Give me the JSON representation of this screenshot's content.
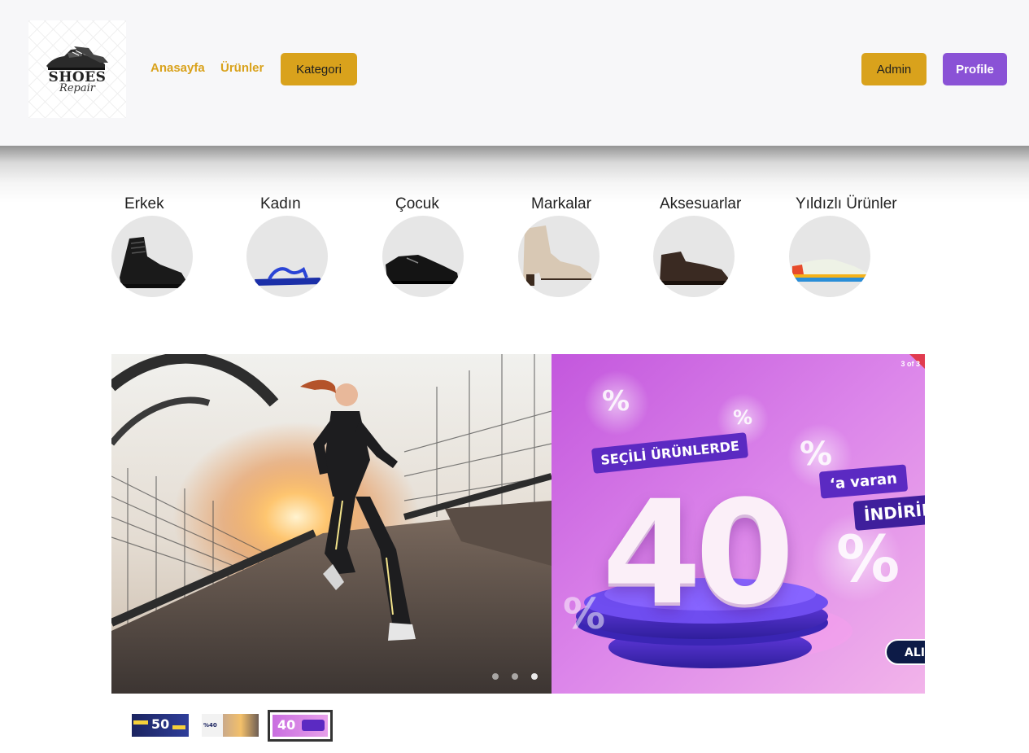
{
  "header": {
    "logo": {
      "title": "SHOES",
      "subtitle": "Repair"
    },
    "nav": {
      "home": "Anasayfa",
      "products": "Ürünler",
      "category": "Kategori"
    },
    "admin_label": "Admin",
    "profile_label": "Profile"
  },
  "categories": [
    {
      "label": "Erkek"
    },
    {
      "label": "Kadın"
    },
    {
      "label": "Çocuk"
    },
    {
      "label": "Markalar"
    },
    {
      "label": "Aksesuarlar"
    },
    {
      "label": "Yıldızlı Ürünler"
    }
  ],
  "carousel": {
    "counter": "3 of 3",
    "promo": {
      "tag1": "SEÇİLİ ÜRÜNLERDE",
      "big_number": "40",
      "tag2": "‘a varan",
      "tag3": "İNDİRİM",
      "button": "ALI",
      "percent_symbol": "%"
    },
    "thumbs": [
      {
        "text": "50"
      },
      {
        "text": "%40"
      },
      {
        "text": "40"
      }
    ]
  },
  "colors": {
    "accent": "#d9a21c",
    "profile": "#8a52d6",
    "header_bg": "#f7f7f9"
  }
}
